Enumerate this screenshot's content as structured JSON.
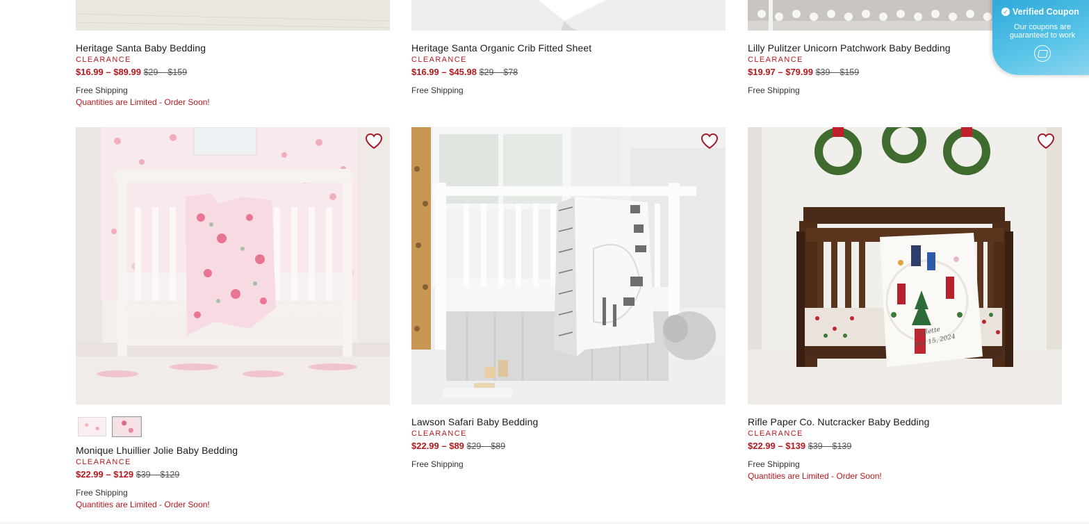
{
  "products_top": [
    {
      "title": "Heritage Santa Baby Bedding",
      "badge": "CLEARANCE",
      "sale_price": "$16.99 – $89.99",
      "orig_price": "$29 – $159",
      "shipping": "Free Shipping",
      "limited": "Quantities are Limited - Order Soon!"
    },
    {
      "title": "Heritage Santa Organic Crib Fitted Sheet",
      "badge": "CLEARANCE",
      "sale_price": "$16.99 – $45.98",
      "orig_price": "$29 – $78",
      "shipping": "Free Shipping"
    },
    {
      "title": "Lilly Pulitzer Unicorn Patchwork Baby Bedding",
      "badge": "CLEARANCE",
      "sale_price": "$19.97 – $79.99",
      "orig_price": "$39 – $159",
      "shipping": "Free Shipping"
    }
  ],
  "products_bottom": [
    {
      "title": "Monique Lhuillier Jolie Baby Bedding",
      "badge": "CLEARANCE",
      "sale_price": "$22.99 – $129",
      "orig_price": "$39 – $129",
      "shipping": "Free Shipping",
      "limited": "Quantities are Limited - Order Soon!",
      "swatches": [
        "pink-floral-light",
        "pink-floral-dark"
      ]
    },
    {
      "title": "Lawson Safari Baby Bedding",
      "badge": "CLEARANCE",
      "sale_price": "$22.99 – $89",
      "orig_price": "$29 – $89",
      "shipping": "Free Shipping"
    },
    {
      "title": "Rifle Paper Co. Nutcracker Baby Bedding",
      "badge": "CLEARANCE",
      "sale_price": "$22.99 – $139",
      "orig_price": "$39 – $139",
      "shipping": "Free Shipping",
      "limited": "Quantities are Limited - Order Soon!"
    }
  ],
  "coupon_widget": {
    "title": "Verified Coupon",
    "subtitle": "Our coupons are guaranteed to work",
    "icon": "coupon-logo-icon"
  },
  "colors": {
    "sale_red": "#b4191d",
    "coupon_blue": "#2aa5d8"
  }
}
